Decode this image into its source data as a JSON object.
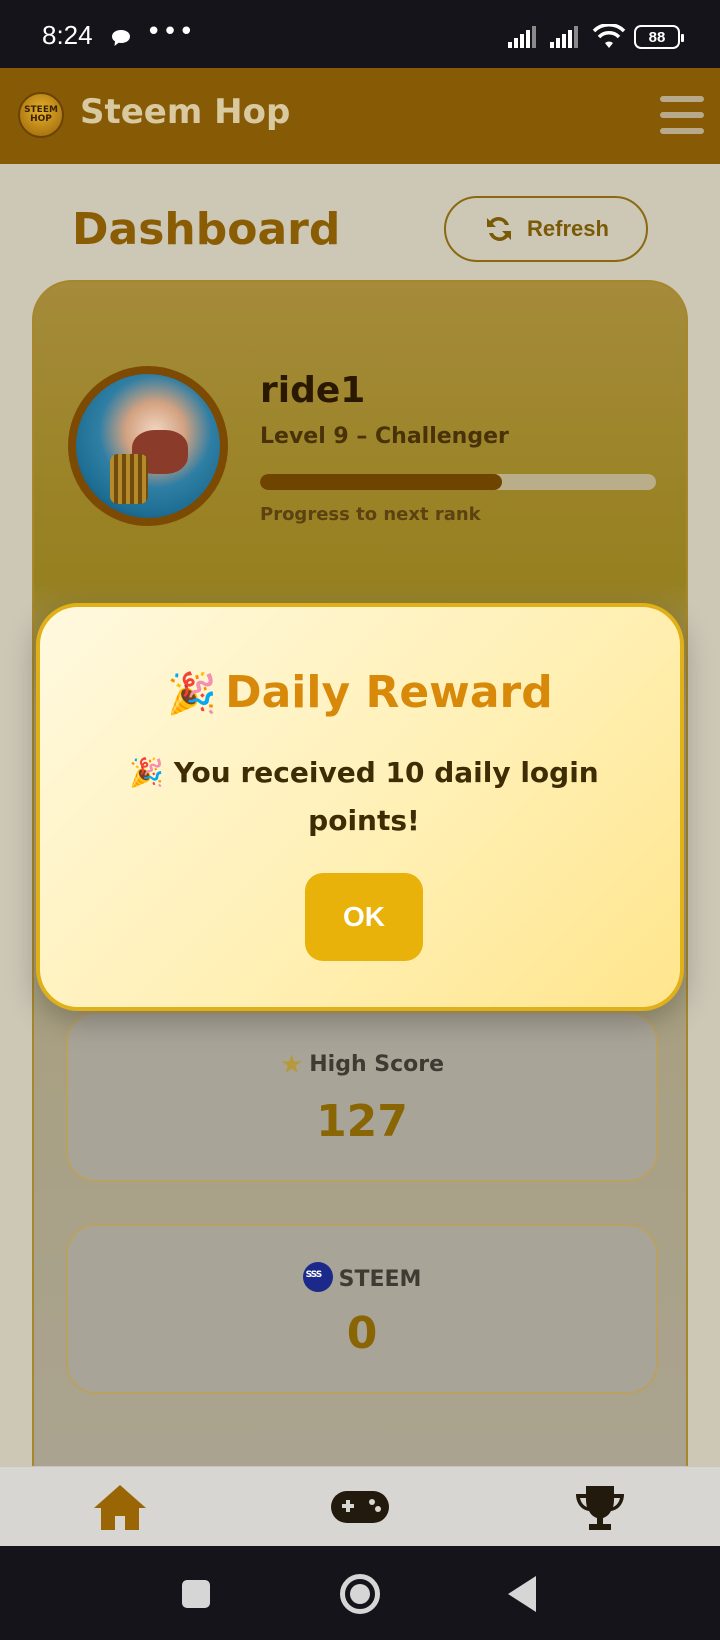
{
  "status_bar": {
    "time": "8:24",
    "dots": "•••",
    "battery": "88"
  },
  "header": {
    "app_title": "Steem Hop",
    "logo_text": "STEEM HOP"
  },
  "dashboard": {
    "title": "Dashboard",
    "refresh_label": "Refresh"
  },
  "profile": {
    "username": "ride1",
    "level": "Level 9 – Challenger",
    "progress_label": "Progress to next rank",
    "progress_fraction": 0.61
  },
  "stats": [
    {
      "label": "High Score",
      "value": "127",
      "icon": "star-icon"
    },
    {
      "label": "STEEM",
      "value": "0",
      "icon": "steem-icon"
    }
  ],
  "modal": {
    "title_emoji": "🎉",
    "title": "Daily Reward",
    "message": "🎉 You received 10 daily login points!",
    "ok_label": "OK"
  },
  "bottom_nav": {
    "items": [
      "home-icon",
      "gamepad-icon",
      "trophy-icon"
    ]
  },
  "colors": {
    "brand": "#875a06",
    "accent": "#e8b20a",
    "title_orange": "#d8890a"
  }
}
